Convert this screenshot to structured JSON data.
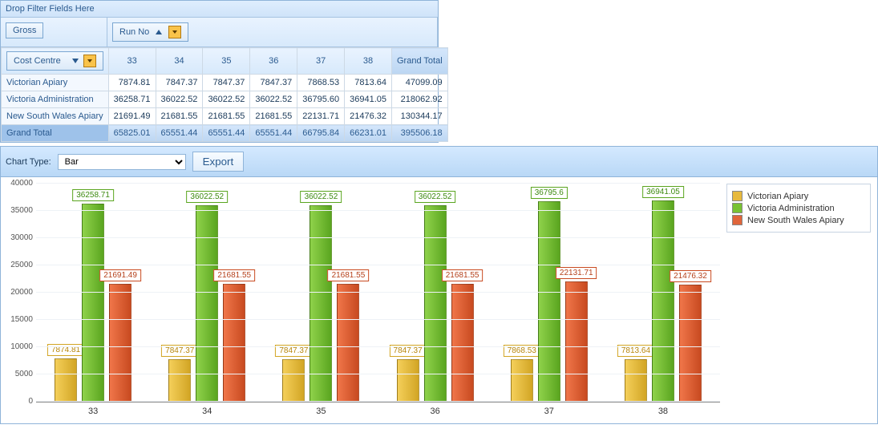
{
  "filter_hint": "Drop Filter Fields Here",
  "data_field": "Gross",
  "col_field": "Run No",
  "row_field": "Cost Centre",
  "grand_total_label": "Grand Total",
  "columns": [
    "33",
    "34",
    "35",
    "36",
    "37",
    "38"
  ],
  "rows": [
    {
      "label": "Victorian Apiary",
      "vals": [
        "7874.81",
        "7847.37",
        "7847.37",
        "7847.37",
        "7868.53",
        "7813.64"
      ],
      "total": "47099.09"
    },
    {
      "label": "Victoria Administration",
      "vals": [
        "36258.71",
        "36022.52",
        "36022.52",
        "36022.52",
        "36795.60",
        "36941.05"
      ],
      "total": "218062.92"
    },
    {
      "label": "New South Wales Apiary",
      "vals": [
        "21691.49",
        "21681.55",
        "21681.55",
        "21681.55",
        "22131.71",
        "21476.32"
      ],
      "total": "130344.17"
    }
  ],
  "col_totals": [
    "65825.01",
    "65551.44",
    "65551.44",
    "65551.44",
    "66795.84",
    "66231.01"
  ],
  "grand_total": "395506.18",
  "chart_type_label": "Chart Type:",
  "chart_type_value": "Bar",
  "export_label": "Export",
  "legend": [
    "Victorian Apiary",
    "Victoria Administration",
    "New South Wales Apiary"
  ],
  "yticks": [
    "0",
    "5000",
    "10000",
    "15000",
    "20000",
    "25000",
    "30000",
    "35000",
    "40000"
  ],
  "chart_data": {
    "type": "bar",
    "categories": [
      "33",
      "34",
      "35",
      "36",
      "37",
      "38"
    ],
    "series": [
      {
        "name": "Victorian Apiary",
        "values": [
          7874.81,
          7847.37,
          7847.37,
          7847.37,
          7868.53,
          7813.64
        ]
      },
      {
        "name": "Victoria Administration",
        "values": [
          36258.71,
          36022.52,
          36022.52,
          36022.52,
          36795.6,
          36941.05
        ]
      },
      {
        "name": "New South Wales Apiary",
        "values": [
          21691.49,
          21681.55,
          21681.55,
          21681.55,
          22131.71,
          21476.32
        ]
      }
    ],
    "ylim": [
      0,
      40000
    ],
    "xlabel": "",
    "ylabel": "",
    "title": ""
  }
}
